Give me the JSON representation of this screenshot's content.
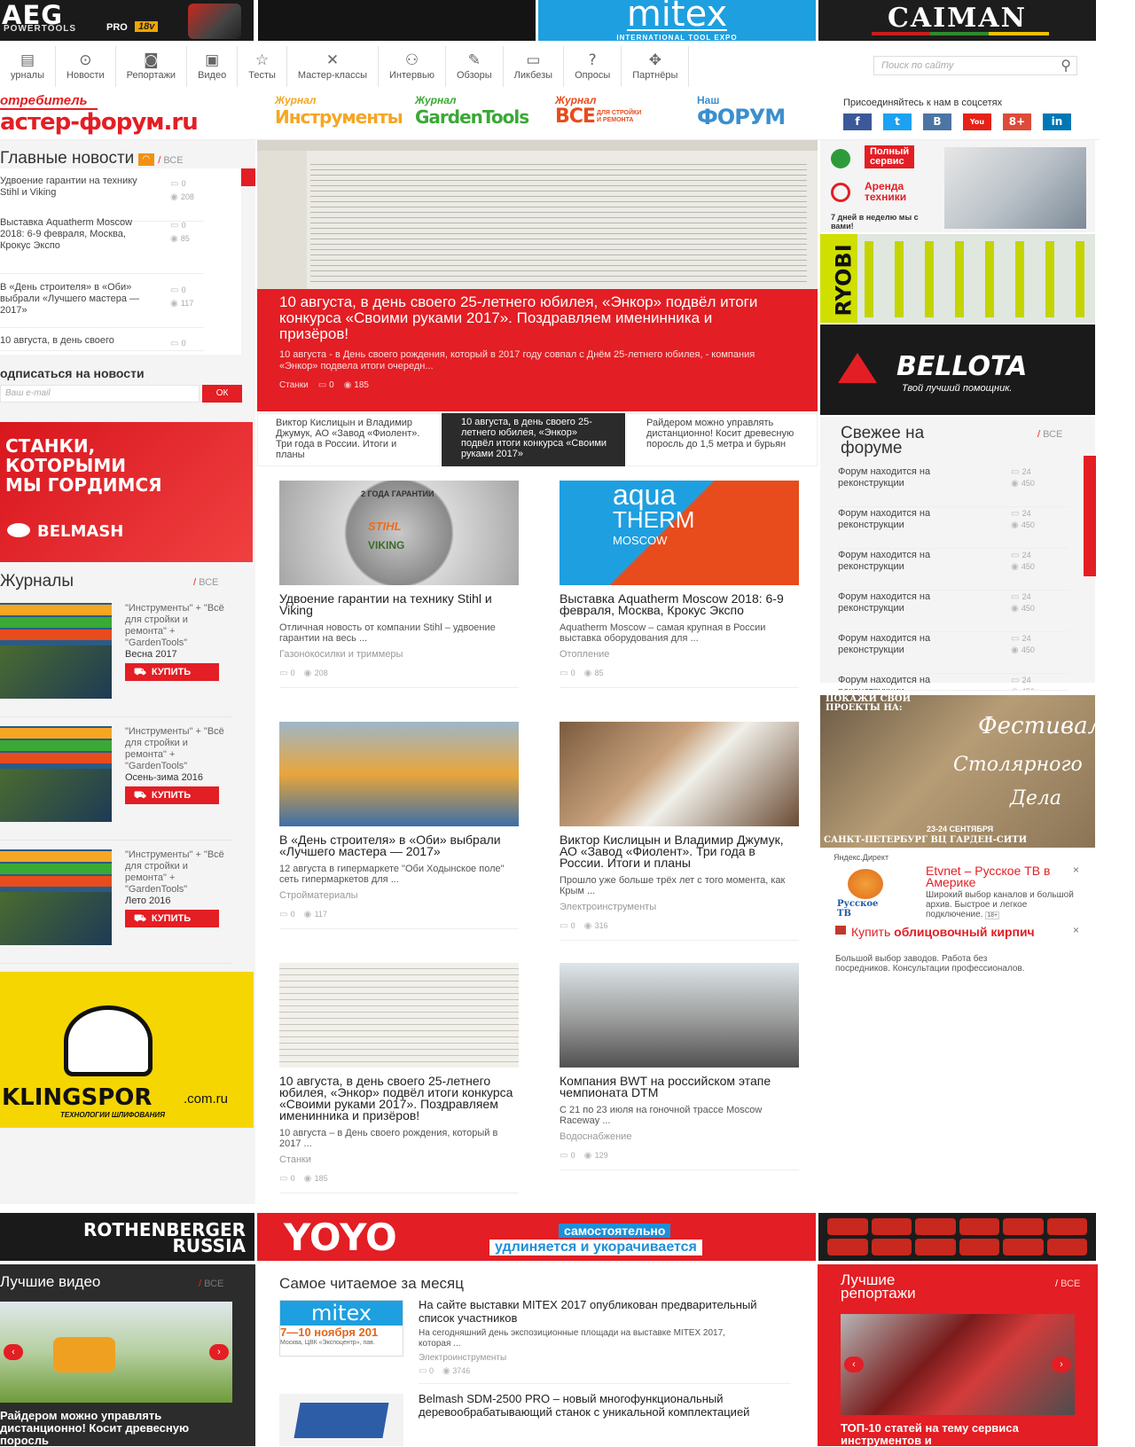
{
  "top_banners": {
    "aeg": "AEG",
    "aeg_sub": "POWERTOOLS",
    "aeg_pro": "PRO",
    "aeg_volt": "18v",
    "mitex": "mitex",
    "mitex_sub": "INTERNATIONAL TOOL EXPO",
    "caiman": "CAIMAN"
  },
  "nav": [
    {
      "label": "урналы",
      "icon": "journal-icon",
      "glyph": "▤"
    },
    {
      "label": "Новости",
      "icon": "news-icon",
      "glyph": "⊙"
    },
    {
      "label": "Репортажи",
      "icon": "camera-icon",
      "glyph": "◙"
    },
    {
      "label": "Видео",
      "icon": "video-icon",
      "glyph": "▣"
    },
    {
      "label": "Тесты",
      "icon": "star-icon",
      "glyph": "☆"
    },
    {
      "label": "Мастер-классы",
      "icon": "tools-icon",
      "glyph": "✕"
    },
    {
      "label": "Интервью",
      "icon": "person-icon",
      "glyph": "⚇"
    },
    {
      "label": "Обзоры",
      "icon": "pencil-icon",
      "glyph": "✎"
    },
    {
      "label": "Ликбезы",
      "icon": "book-icon",
      "glyph": "▭"
    },
    {
      "label": "Опросы",
      "icon": "question-icon",
      "glyph": "?"
    },
    {
      "label": "Партнёры",
      "icon": "handshake-icon",
      "glyph": "✥"
    }
  ],
  "search": {
    "placeholder": "Поиск по сайту"
  },
  "logo": {
    "top": "отребитель",
    "main": "астер-форум.ru"
  },
  "magazines": [
    {
      "pre": "Журнал",
      "name": "Инструменты",
      "color": "#f5a623"
    },
    {
      "pre": "Журнал",
      "name": "GardenTools",
      "color": "#3aa935"
    },
    {
      "pre": "Журнал",
      "name": "ВСЕ",
      "name2": "ДЛЯ СТРОЙКИ И РЕМОНТА",
      "color": "#e84c1c"
    },
    {
      "pre": "Наш",
      "name": "ФОРУМ",
      "color": "#3a8fd0"
    }
  ],
  "social": {
    "title": "Присоединяйтесь к нам в соцсетях",
    "items": [
      {
        "name": "facebook-icon",
        "t": "f",
        "c": "#3b5998"
      },
      {
        "name": "twitter-icon",
        "t": "t",
        "c": "#1da1f2"
      },
      {
        "name": "vk-icon",
        "t": "B",
        "c": "#4c75a3"
      },
      {
        "name": "youtube-icon",
        "t": "You",
        "c": "#e62117"
      },
      {
        "name": "gplus-icon",
        "t": "8+",
        "c": "#dd4b39"
      },
      {
        "name": "linkedin-icon",
        "t": "in",
        "c": "#0077b5"
      }
    ]
  },
  "main_news": {
    "title": "Главные новости",
    "all": "ВСЕ",
    "items": [
      {
        "title": "Удвоение гарантии на технику Stihl и Viking",
        "comments": "0",
        "views": "208"
      },
      {
        "title": "Выставка Aquatherm Moscow 2018: 6-9 февраля, Москва, Крокус Экспо",
        "comments": "0",
        "views": "85"
      },
      {
        "title": "В «День строителя» в «Оби» выбрали «Лучшего мастера — 2017»",
        "comments": "0",
        "views": "117"
      },
      {
        "title": "10 августа, в день своего",
        "comments": "0",
        "views": ""
      }
    ]
  },
  "subscribe": {
    "title": "одписаться на новости",
    "placeholder": "Ваш e-mail",
    "button": "ОК"
  },
  "belmash": {
    "text1": "СТАНКИ,",
    "text2": "КОТОРЫМИ",
    "text3": "МЫ ГОРДИМСЯ",
    "brand": "BELMASH"
  },
  "journals": {
    "title": "Журналы",
    "all": "ВСЕ",
    "items": [
      {
        "text": "\"Инструменты\" + \"Всё для стройки и ремонта\" + \"GardenTools\"",
        "season": "Весна 2017",
        "buy": "КУПИТЬ"
      },
      {
        "text": "\"Инструменты\" + \"Всё для стройки и ремонта\" + \"GardenTools\"",
        "season": "Осень-зима 2016",
        "buy": "КУПИТЬ"
      },
      {
        "text": "\"Инструменты\" + \"Всё для стройки и ремонта\" + \"GardenTools\"",
        "season": "Лето 2016",
        "buy": "КУПИТЬ"
      }
    ]
  },
  "klingspor": {
    "brand": "KLINGSPOR",
    "domain": ".com.ru",
    "sub": "ТЕХНОЛОГИИ ШЛИФОВАНИЯ"
  },
  "hero": {
    "title": "10 августа, в день своего 25-летнего юбилея, «Энкор» подвёл итоги конкурса «Своими руками 2017». Поздравляем именинника и призёров!",
    "lead": "10 августа - в День своего рождения, который в 2017 году совпал с Днём 25-летнего юбилея, - компания «Энкор» подвела итоги очередн...",
    "category": "Станки",
    "comments": "0",
    "views": "185"
  },
  "slider_tabs": [
    "Виктор Кислицын и Владимир Джумук, АО «Завод «Фиолент». Три года в России. Итоги и планы",
    "10 августа, в день своего 25-летнего юбилея, «Энкор» подвёл итоги конкурса «Своими руками 2017»",
    "Райдером можно управлять дистанционно! Косит древесную поросль до 1,5 метра и бурьян"
  ],
  "cards": [
    {
      "title": "Удвоение гарантии на технику Stihl и Viking",
      "text": "Отличная новость от компании Stihl – удвоение гарантии на весь ...",
      "cat": "Газонокосилки и триммеры",
      "comments": "0",
      "views": "208",
      "img_label": "2 ГОДА ГАРАНТИИ",
      "img_brand": "STIHL",
      "img_brand2": "VIKING"
    },
    {
      "title": "Выставка Aquatherm Moscow 2018: 6-9 февраля, Москва, Крокус Экспо",
      "text": "Aquatherm Moscow – самая крупная в России выставка оборудования для ...",
      "cat": "Отопление",
      "comments": "0",
      "views": "85",
      "img_label": "aqua",
      "img_brand": "THERM",
      "img_brand2": "MOSCOW"
    },
    {
      "title": "В «День строителя» в «Оби» выбрали «Лучшего мастера — 2017»",
      "text": "12 августа в гипермаркете \"Оби Ходынское поле\" сеть гипермаркетов для ...",
      "cat": "Стройматериалы",
      "comments": "0",
      "views": "117"
    },
    {
      "title": "Виктор Кислицын и Владимир Джумук, АО «Завод «Фиолент». Три года в России. Итоги и планы",
      "text": "Прошло уже больше трёх лет с того момента, как Крым ...",
      "cat": "Электроинструменты",
      "comments": "0",
      "views": "316"
    },
    {
      "title": "10 августа, в день своего 25-летнего юбилея, «Энкор» подвёл итоги конкурса «Своими руками 2017». Поздравляем именинника и призёров!",
      "text": "10 августа – в День своего рождения, который в 2017 ...",
      "cat": "Станки",
      "comments": "0",
      "views": "185"
    },
    {
      "title": "Компания BWT на российском этапе чемпионата DTM",
      "text": "С 21 по 23 июля на гоночной трассе Moscow Raceway ...",
      "cat": "Водоснабжение",
      "comments": "0",
      "views": "129"
    }
  ],
  "right_ads": {
    "service1": "Полный",
    "service2": "сервис",
    "rent1": "Аренда",
    "rent2": "техники",
    "week": "7 дней в неделю мы с вами!",
    "ryobi": "RYOBI",
    "bellota": "BELLOTA",
    "bellota_sub": "Твой лучший помощник."
  },
  "fresh": {
    "title": "Свежее на форуме",
    "all": "ВСЕ",
    "items": [
      {
        "title": "Форум находится на реконструкции",
        "c": "24",
        "v": "450"
      },
      {
        "title": "Форум находится на реконструкции",
        "c": "24",
        "v": "450"
      },
      {
        "title": "Форум находится на реконструкции",
        "c": "24",
        "v": "450"
      },
      {
        "title": "Форум находится на реконструкции",
        "c": "24",
        "v": "450"
      },
      {
        "title": "Форум находится на реконструкции",
        "c": "24",
        "v": "450"
      },
      {
        "title": "Форум находится на реконструкции",
        "c": "24",
        "v": "450"
      }
    ]
  },
  "festival": {
    "top": "ПОКАЖИ СВОИ ПРОЕКТЫ НА:",
    "f1": "Фестиваль",
    "f2": "Столярного",
    "f3": "Дела",
    "date": "23-24 СЕНТЯБРЯ",
    "place": "САНКТ-ПЕТЕРБУРГ   ВЦ ГАРДЕН-СИТИ"
  },
  "yandex": {
    "label": "Яндекс.Директ",
    "ad1_title": "Etvnet – Русское ТВ в Америке",
    "ad1_text": "Широкий выбор каналов и большой архив. Быстрое и легкое подключение.",
    "ad1_age": "18+",
    "ad1_logo": "Русское ТВ",
    "ad2_title": "Купить",
    "ad2_bold": "облицовочный кирпич",
    "ad2_text": "Большой выбор заводов. Работа без посредников. Консультации профессионалов."
  },
  "bottom_banners": {
    "rothenberger": "ROTHENBERGER",
    "rothenberger2": "RUSSIA",
    "yoyo": "YOYO",
    "yoyo1": "самостоятельно",
    "yoyo2": "удлиняется и укорачивается"
  },
  "best_video": {
    "title": "Лучшие видео",
    "all": "ВСЕ",
    "caption": "Райдером можно управлять дистанционно! Косит древесную поросль"
  },
  "most_read": {
    "title": "Самое читаемое за месяц",
    "items": [
      {
        "title": "На сайте выставки MITEX 2017 опубликован предварительный список участников",
        "text": "На сегодняшний день экспозиционные площади на выставке MITEX 2017, которая ...",
        "cat": "Электроинструменты",
        "comments": "0",
        "views": "3746",
        "img1": "mitex",
        "img2": "7—10 ноября 201",
        "img3": "Москва, ЦВК «Экспоцентр», пав."
      },
      {
        "title": "Belmash SDM-2500 PRO – новый многофункциональный деревообрабатывающий станок с уникальной комплектацией"
      }
    ]
  },
  "best_reports": {
    "title": "Лучшие репортажи",
    "all": "ВСЕ",
    "caption": "ТОП-10 статей на тему сервиса инструментов и"
  }
}
